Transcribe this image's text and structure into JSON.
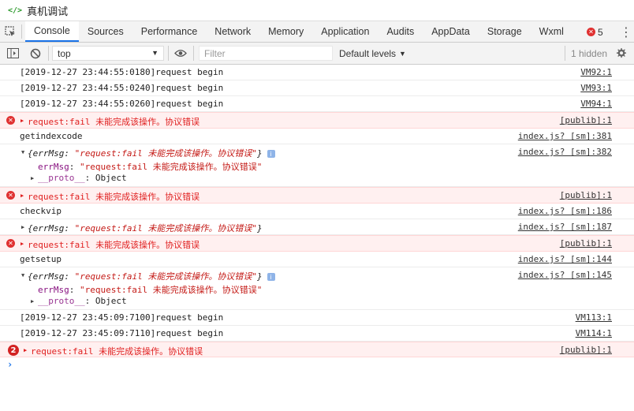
{
  "window": {
    "title": "真机调试",
    "title_icon": "code-icon"
  },
  "tabs": [
    {
      "label": "Console",
      "active": true
    },
    {
      "label": "Sources"
    },
    {
      "label": "Performance"
    },
    {
      "label": "Network"
    },
    {
      "label": "Memory"
    },
    {
      "label": "Application"
    },
    {
      "label": "Audits"
    },
    {
      "label": "AppData"
    },
    {
      "label": "Storage"
    },
    {
      "label": "Wxml"
    }
  ],
  "error_badge": {
    "count": "5",
    "icon": "✕"
  },
  "more_icon": "⋮",
  "filterbar": {
    "context": "top",
    "filter_placeholder": "Filter",
    "levels": "Default levels",
    "levels_arrow": "▼",
    "hidden": "1 hidden"
  },
  "colors": {
    "error_text": "#e01f1f",
    "error_bg": "#fff0f0",
    "accent": "#1a73e8",
    "key": "#881280",
    "string": "#c41a16"
  },
  "console": {
    "log1": {
      "text": "[2019-12-27 23:44:55:0180]request begin",
      "src": "VM92:1"
    },
    "log2": {
      "text": "[2019-12-27 23:44:55:0240]request begin",
      "src": "VM93:1"
    },
    "log3": {
      "text": "[2019-12-27 23:44:55:0260]request begin",
      "src": "VM94:1"
    },
    "err1": {
      "text": "request:fail 未能完成该操作。协议错误",
      "src": "[publib]:1"
    },
    "log4": {
      "text": "getindexcode",
      "src": "index.js? [sm]:381"
    },
    "obj1": {
      "summary_open": "{errMsg: ",
      "summary_value": "\"request:fail 未能完成该操作。协议错误\"",
      "summary_close": "}",
      "src": "index.js? [sm]:382",
      "key": "errMsg",
      "value": "\"request:fail 未能完成该操作。协议错误\"",
      "proto_key": "__proto__",
      "proto_value": "Object"
    },
    "err2": {
      "text": "request:fail 未能完成该操作。协议错误",
      "src": "[publib]:1"
    },
    "log5": {
      "text": "checkvip",
      "src": "index.js? [sm]:186"
    },
    "obj2": {
      "summary_open": "{errMsg: ",
      "summary_value": "\"request:fail 未能完成该操作。协议错误\"",
      "summary_close": "}",
      "src": "index.js? [sm]:187"
    },
    "err3": {
      "text": "request:fail 未能完成该操作。协议错误",
      "src": "[publib]:1"
    },
    "log6": {
      "text": "getsetup",
      "src": "index.js? [sm]:144"
    },
    "obj3": {
      "summary_open": "{errMsg: ",
      "summary_value": "\"request:fail 未能完成该操作。协议错误\"",
      "summary_close": "}",
      "src": "index.js? [sm]:145",
      "key": "errMsg",
      "value": "\"request:fail 未能完成该操作。协议错误\"",
      "proto_key": "__proto__",
      "proto_value": "Object"
    },
    "log7": {
      "text": "[2019-12-27 23:45:09:7100]request begin",
      "src": "VM113:1"
    },
    "log8": {
      "text": "[2019-12-27 23:45:09:7110]request begin",
      "src": "VM114:1"
    },
    "err4": {
      "count": "2",
      "text": "request:fail 未能完成该操作。协议错误",
      "src": "[publib]:1"
    },
    "prompt": "›"
  }
}
